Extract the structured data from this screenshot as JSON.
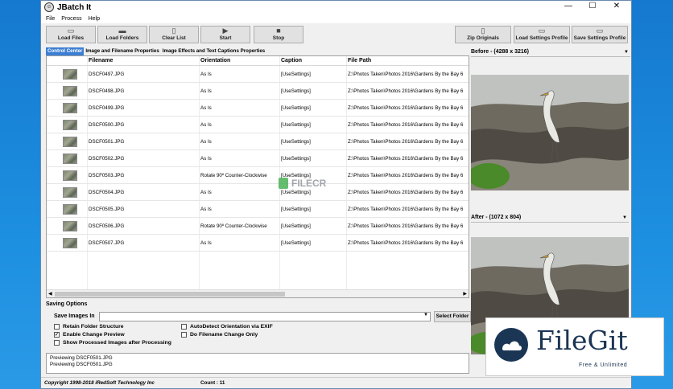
{
  "window": {
    "title": "JBatch It"
  },
  "menu": [
    "File",
    "Process",
    "Help"
  ],
  "toolbar": {
    "left": [
      {
        "label": "Load Files",
        "icon": "image-icon"
      },
      {
        "label": "Load Folders",
        "icon": "folder-icon"
      },
      {
        "label": "Clear List",
        "icon": "doc-icon"
      },
      {
        "label": "Start",
        "icon": "play-icon"
      },
      {
        "label": "Stop",
        "icon": "stop-icon"
      }
    ],
    "right": [
      {
        "label": "Zip Originals",
        "icon": "zip-icon"
      },
      {
        "label": "Load Settings Profile",
        "icon": "open-icon"
      },
      {
        "label": "Save Settings Profile",
        "icon": "save-icon"
      }
    ]
  },
  "tabs": [
    "Control Center",
    "Image and Filename Properties",
    "Image Effects and Text Captions Properties"
  ],
  "grid": {
    "columns": [
      "Filename",
      "Orientation",
      "Caption",
      "File Path"
    ],
    "rows": [
      {
        "filename": "DSCF0497.JPG",
        "orientation": "As Is",
        "caption": "[UseSettings]",
        "path": "Z:\\Photos Taken\\Photos 2016\\Gardens By the Bay 6"
      },
      {
        "filename": "DSCF0498.JPG",
        "orientation": "As Is",
        "caption": "[UseSettings]",
        "path": "Z:\\Photos Taken\\Photos 2016\\Gardens By the Bay 6"
      },
      {
        "filename": "DSCF0499.JPG",
        "orientation": "As Is",
        "caption": "[UseSettings]",
        "path": "Z:\\Photos Taken\\Photos 2016\\Gardens By the Bay 6"
      },
      {
        "filename": "DSCF0500.JPG",
        "orientation": "As Is",
        "caption": "[UseSettings]",
        "path": "Z:\\Photos Taken\\Photos 2016\\Gardens By the Bay 6"
      },
      {
        "filename": "DSCF0501.JPG",
        "orientation": "As Is",
        "caption": "[UseSettings]",
        "path": "Z:\\Photos Taken\\Photos 2016\\Gardens By the Bay 6"
      },
      {
        "filename": "DSCF0502.JPG",
        "orientation": "As Is",
        "caption": "[UseSettings]",
        "path": "Z:\\Photos Taken\\Photos 2016\\Gardens By the Bay 6"
      },
      {
        "filename": "DSCF0503.JPG",
        "orientation": "Rotate 90º Counter-Clockwise",
        "caption": "[UseSettings]",
        "path": "Z:\\Photos Taken\\Photos 2016\\Gardens By the Bay 6"
      },
      {
        "filename": "DSCF0504.JPG",
        "orientation": "As Is",
        "caption": "[UseSettings]",
        "path": "Z:\\Photos Taken\\Photos 2016\\Gardens By the Bay 6"
      },
      {
        "filename": "DSCF0505.JPG",
        "orientation": "As Is",
        "caption": "[UseSettings]",
        "path": "Z:\\Photos Taken\\Photos 2016\\Gardens By the Bay 6"
      },
      {
        "filename": "DSCF0506.JPG",
        "orientation": "Rotate 90º Counter-Clockwise",
        "caption": "[UseSettings]",
        "path": "Z:\\Photos Taken\\Photos 2016\\Gardens By the Bay 6"
      },
      {
        "filename": "DSCF0507.JPG",
        "orientation": "As Is",
        "caption": "[UseSettings]",
        "path": "Z:\\Photos Taken\\Photos 2016\\Gardens By the Bay 6"
      }
    ]
  },
  "saving": {
    "header": "Saving Options",
    "save_label": "Save Images In",
    "save_value": "",
    "select_folder": "Select Folder",
    "options": [
      {
        "label": "Retain Folder Structure",
        "checked": false
      },
      {
        "label": "Enable Change Preview",
        "checked": true
      },
      {
        "label": "Show Processed Images after Processing",
        "checked": false
      },
      {
        "label": "AutoDetect Orientation via EXIF",
        "checked": false
      },
      {
        "label": "Do Filename Change Only",
        "checked": false
      }
    ]
  },
  "log": [
    "Previewing DSCF0501.JPG",
    "Previewing DSCF0501.JPG"
  ],
  "status": {
    "copyright": "Copyright 1998-2018 iRedSoft Technology Inc",
    "count": "Count : 11"
  },
  "preview": {
    "before": "Before - (4288 x 3216)",
    "after": "After - (1072 x 804)"
  },
  "watermark": "FILECR",
  "filegit": {
    "name": "FileGit",
    "tagline": "Free & Unlimited"
  }
}
